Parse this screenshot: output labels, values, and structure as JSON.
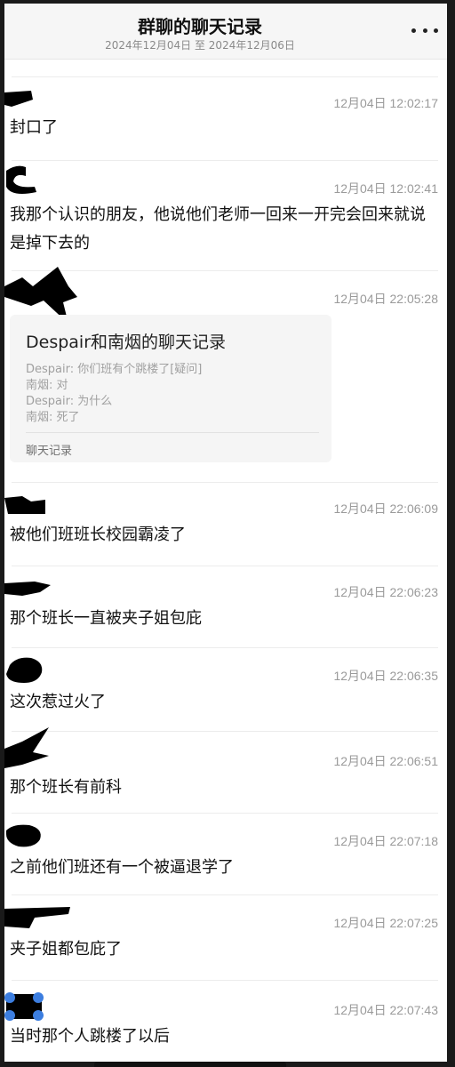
{
  "header": {
    "title": "群聊的聊天记录",
    "date_range": "2024年12月04日 至 2024年12月06日",
    "more_icon": "more-dots-icon"
  },
  "messages": [
    {
      "time": "12月04日 12:02:17",
      "text": "封口了"
    },
    {
      "time": "12月04日 12:02:41",
      "text": "我那个认识的朋友，他说他们老师一回来一开完会回来就说是掉下去的"
    },
    {
      "time": "12月04日 22:05:28",
      "card": {
        "title": "Despair和南烟的聊天记录",
        "lines": [
          "Despair: 你们班有个跳楼了[疑问]",
          "南烟: 对",
          "Despair: 为什么",
          "南烟: 死了"
        ],
        "label": "聊天记录"
      }
    },
    {
      "time": "12月04日 22:06:09",
      "text": "被他们班班长校园霸凌了"
    },
    {
      "time": "12月04日 22:06:23",
      "text": "那个班长一直被夹子姐包庇"
    },
    {
      "time": "12月04日 22:06:35",
      "text": "这次惹过火了"
    },
    {
      "time": "12月04日 22:06:51",
      "text": "那个班长有前科"
    },
    {
      "time": "12月04日 22:07:18",
      "text": "之前他们班还有一个被逼退学了"
    },
    {
      "time": "12月04日 22:07:25",
      "text": "夹子姐都包庇了"
    },
    {
      "time": "12月04日 22:07:43",
      "text": "当时那个人跳楼了以后"
    }
  ],
  "colors": {
    "text": "#111111",
    "meta": "#9a9a9a",
    "card_bg": "#f5f5f5",
    "redaction": "#000000"
  }
}
